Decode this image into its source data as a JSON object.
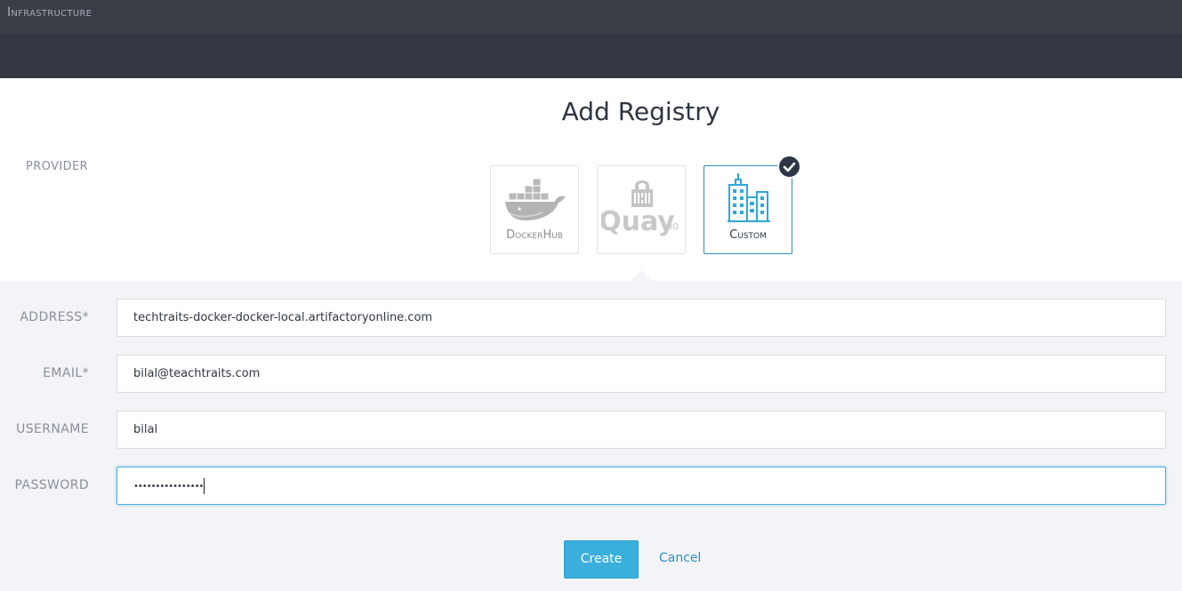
{
  "app": {
    "title": "Infrastructure"
  },
  "page": {
    "title": "Add Registry"
  },
  "provider": {
    "label": "PROVIDER",
    "options": [
      {
        "label": "DockerHub",
        "icon": "docker-whale-icon",
        "selected": false
      },
      {
        "label": "Quay.io",
        "icon": "quay-logo-icon",
        "selected": false
      },
      {
        "label": "Custom",
        "icon": "buildings-icon",
        "selected": true
      }
    ]
  },
  "form": {
    "address": {
      "label": "ADDRESS*",
      "value": "techtraits-docker-docker-local.artifactoryonline.com"
    },
    "email": {
      "label": "EMAIL*",
      "value": "bilal@teachtraits.com"
    },
    "username": {
      "label": "USERNAME",
      "value": "bilal"
    },
    "password": {
      "label": "PASSWORD",
      "value": "••••••••••••••••"
    }
  },
  "actions": {
    "create_label": "Create",
    "cancel_label": "Cancel"
  },
  "colors": {
    "accent": "#3aafdb",
    "selected_border": "#2a8fb6",
    "header_bg": "#3b3e47",
    "badge": "#2c3644"
  }
}
